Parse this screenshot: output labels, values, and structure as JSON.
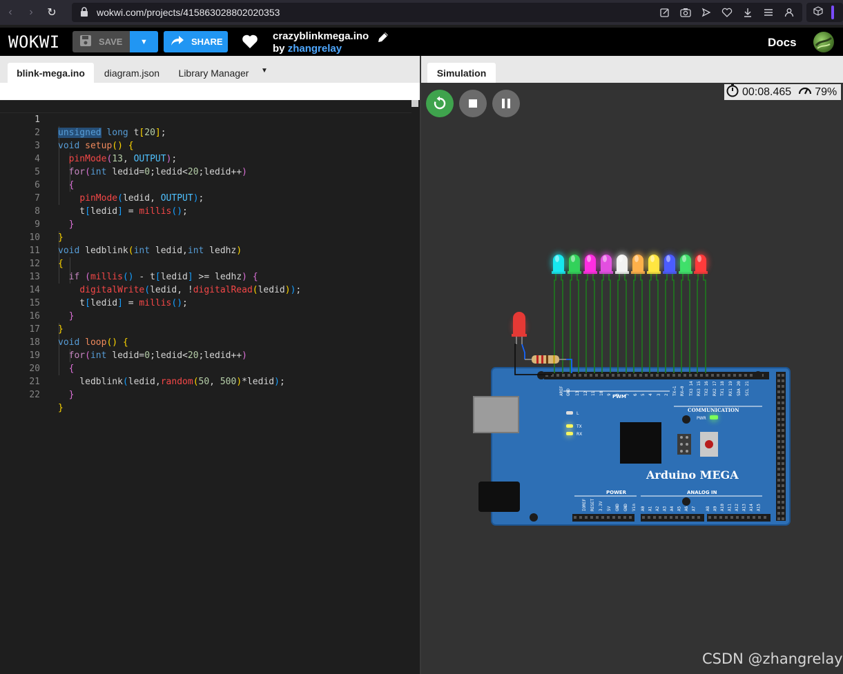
{
  "browser": {
    "url": "wokwi.com/projects/415863028802020353"
  },
  "header": {
    "logo": "WOKWI",
    "save_label": "SAVE",
    "share_label": "SHARE",
    "project_title": "crazyblinkmega.ino",
    "by_label": "by",
    "author": "zhangrelay",
    "docs_label": "Docs"
  },
  "editor": {
    "tabs": [
      {
        "label": "blink-mega.ino"
      },
      {
        "label": "diagram.json"
      },
      {
        "label": "Library Manager"
      }
    ],
    "line_numbers": [
      "1",
      "2",
      "3",
      "4",
      "5",
      "6",
      "7",
      "8",
      "9",
      "10",
      "11",
      "12",
      "13",
      "14",
      "15",
      "16",
      "17",
      "18",
      "19",
      "20",
      "21",
      "22"
    ]
  },
  "simulation": {
    "tab_label": "Simulation",
    "elapsed": "00:08.465",
    "speed": "79%",
    "board_label": "Arduino MEGA",
    "pwm_label": "PWM",
    "comm_label": "COMMUNICATION",
    "power_label": "POWER",
    "analog_label": "ANALOG IN",
    "pwr_label": "PWR",
    "l_label": "L",
    "tx_label": "TX",
    "rx_label": "RX",
    "top_pins": [
      "AREF",
      "GND",
      "13",
      "12",
      "11",
      "10",
      "9",
      "8",
      "7",
      "6",
      "5",
      "4",
      "3",
      "2",
      "TX→1",
      "RX←0",
      "TX3 14",
      "RX3 15",
      "TX2 16",
      "RX2 17",
      "TX1 18",
      "RX1 19",
      "SDA 20",
      "SCL 21"
    ],
    "power_pins": [
      "IOREF",
      "RESET",
      "3.3V",
      "5V",
      "GND",
      "GND",
      "Vin"
    ],
    "analog_pins": [
      "A0",
      "A1",
      "A2",
      "A3",
      "A4",
      "A5",
      "A6",
      "A7",
      "A8",
      "A9",
      "A10",
      "A11",
      "A12",
      "A13",
      "A14",
      "A15"
    ],
    "led_colors": [
      "#17e8f0",
      "#32d25a",
      "#ff2ee0",
      "#e24fe0",
      "#f2f2f2",
      "#ffb04a",
      "#ffe640",
      "#4b5cff",
      "#3fe06a",
      "#ff3b3b"
    ]
  },
  "watermark": "CSDN @zhangrelay"
}
